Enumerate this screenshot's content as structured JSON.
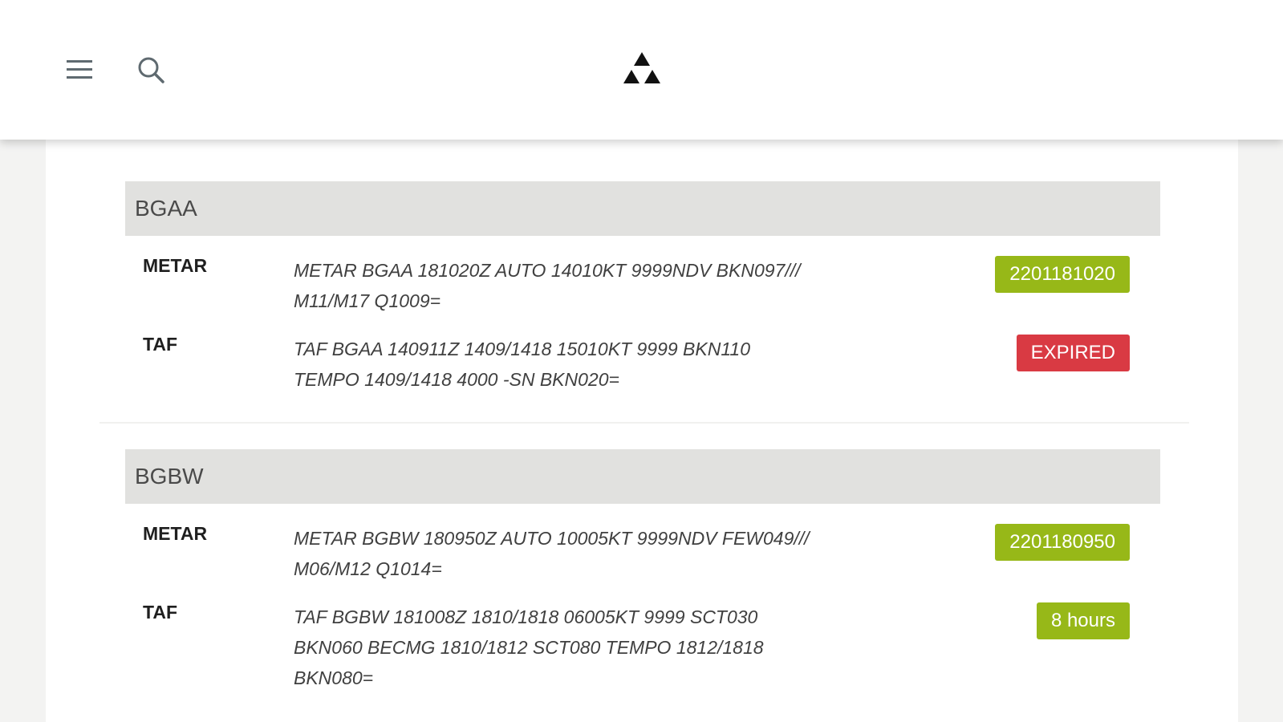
{
  "header": {
    "menu_icon": "hamburger-menu-icon",
    "search_icon": "search-icon",
    "logo_icon": "triangles-logo-icon"
  },
  "colors": {
    "valid": "#97b818",
    "expired": "#d93a43",
    "station_header_bg": "#e1e1df"
  },
  "stations": [
    {
      "code": "BGAA",
      "reports": [
        {
          "type": "METAR",
          "line1": "METAR BGAA 181020Z AUTO 14010KT 9999NDV BKN097///",
          "line2": "M11/M17 Q1009=",
          "badge": "2201181020",
          "badge_status": "valid"
        },
        {
          "type": "TAF",
          "line1": "TAF BGAA 140911Z 1409/1418 15010KT 9999 BKN110",
          "line2": "TEMPO 1409/1418 4000 -SN BKN020=",
          "badge": "EXPIRED",
          "badge_status": "expired"
        }
      ]
    },
    {
      "code": "BGBW",
      "reports": [
        {
          "type": "METAR",
          "line1": "METAR BGBW 180950Z AUTO 10005KT 9999NDV FEW049///",
          "line2": "M06/M12 Q1014=",
          "badge": "2201180950",
          "badge_status": "valid"
        },
        {
          "type": "TAF",
          "line1": "TAF BGBW 181008Z 1810/1818 06005KT 9999 SCT030",
          "line2": "BKN060 BECMG 1810/1812 SCT080 TEMPO 1812/1818",
          "line3": "BKN080=",
          "badge": "8 hours",
          "badge_status": "valid"
        }
      ]
    }
  ]
}
